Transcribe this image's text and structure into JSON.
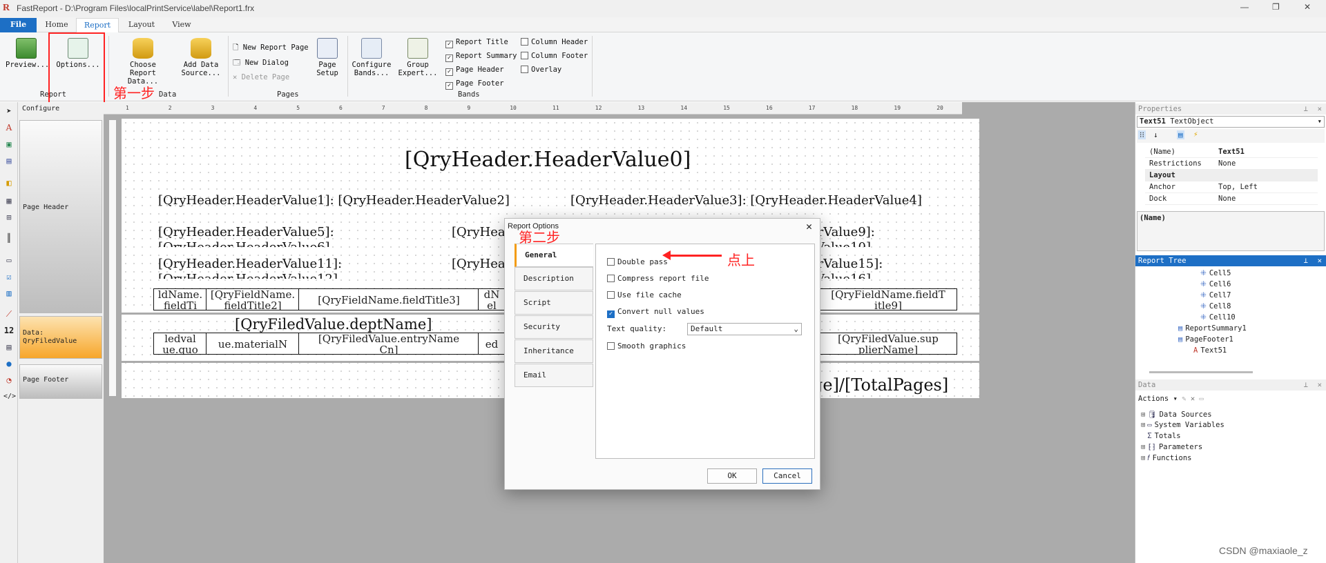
{
  "window": {
    "title": "FastReport - D:\\Program Files\\localPrintService\\label\\Report1.frx",
    "controls": [
      "—",
      "❐",
      "✕"
    ]
  },
  "tabs": [
    "File",
    "Home",
    "Report",
    "Layout",
    "View"
  ],
  "ribbon": {
    "preview": "Preview...",
    "options": "Options...",
    "report_group": "Report",
    "choose_data": "Choose Report Data...",
    "add_source": "Add Data Source...",
    "data_group": "Data",
    "new_page": "New Report Page",
    "new_dialog": "New Dialog",
    "delete_page": "Delete Page",
    "page_setup": "Page Setup",
    "pages_group": "Pages",
    "configure": "Configure Bands...",
    "group_expert": "Group Expert...",
    "bands_group": "Bands",
    "checks": [
      {
        "label": "Report Title",
        "checked": true
      },
      {
        "label": "Report Summary",
        "checked": true
      },
      {
        "label": "Page Header",
        "checked": true
      },
      {
        "label": "Page Footer",
        "checked": true
      },
      {
        "label": "Column Header",
        "checked": false
      },
      {
        "label": "Column Footer",
        "checked": false
      },
      {
        "label": "Overlay",
        "checked": false
      }
    ]
  },
  "annotations": {
    "step1": "第一步",
    "step2": "第二步",
    "click": "点上",
    "watermark": "CSDN @maxiaole_z"
  },
  "left_panel": {
    "configure": "Configure",
    "bands": [
      "Page Header",
      "Data: QryFiledValue",
      "Page Footer"
    ]
  },
  "ruler": [
    "1",
    "2",
    "3",
    "4",
    "5",
    "6",
    "7",
    "8",
    "9",
    "10",
    "11",
    "12",
    "13",
    "14",
    "15",
    "16",
    "17",
    "18",
    "19",
    "20"
  ],
  "report": {
    "header0": "[QryHeader.HeaderValue0]",
    "row1a": "[QryHeader.HeaderValue1]: [QryHeader.HeaderValue2]",
    "row1b": "[QryHeader.HeaderValue3]: [QryHeader.HeaderValue4]",
    "row2a": "[QryHeader.HeaderValue5]:",
    "row2a2": "[QryHeader.HeaderValue6]",
    "row2b": "[QryHeade",
    "row2c": "erValue9]:",
    "row2c2": "Value10]",
    "row3a": "[QryHeader.HeaderValue11]:",
    "row3a2": "[QryHeader.HeaderValue12]",
    "row3b": "[QryHeade",
    "row3c": "erValue15]:",
    "row3c2": "Value16]",
    "cells_top": [
      "ldName.\nfieldTi",
      "[QryFieldName.\nfieldTitle2]",
      "[QryFieldName.fieldTitle3]",
      "dN\nel",
      "[QryFieldName.fieldT\nitle9]"
    ],
    "dept": "[QryFiledValue.deptName]",
    "cells_bottom": [
      "ledval\nue.quo",
      "ue.materialN",
      "[QryFiledValue.entryName\nCn]",
      "ed",
      "[QryFiledValue.sup\nplierName]"
    ],
    "footer": "ge]/[TotalPages]"
  },
  "dialog": {
    "title": "Report Options",
    "tabs": [
      "General",
      "Description",
      "Script",
      "Security",
      "Inheritance",
      "Email"
    ],
    "options": [
      {
        "label": "Double pass",
        "checked": false
      },
      {
        "label": "Compress report file",
        "checked": false
      },
      {
        "label": "Use file cache",
        "checked": false
      },
      {
        "label": "Convert null values",
        "checked": true
      }
    ],
    "quality_label": "Text quality:",
    "quality_value": "Default",
    "smooth": "Smooth graphics",
    "ok": "OK",
    "cancel": "Cancel"
  },
  "properties": {
    "header": "Properties",
    "object": "Text51",
    "object_type": "TextObject",
    "rows": [
      [
        "(Name)",
        "Text51"
      ],
      [
        "Restrictions",
        "None"
      ],
      [
        "Layout",
        ""
      ],
      [
        "Anchor",
        "Top, Left"
      ],
      [
        "Dock",
        "None"
      ]
    ],
    "desc": "(Name)"
  },
  "report_tree": {
    "header": "Report Tree",
    "items": [
      "Cell5",
      "Cell6",
      "Cell7",
      "Cell8",
      "Cell10",
      "ReportSummary1",
      "PageFooter1",
      "Text51"
    ]
  },
  "data_panel": {
    "header": "Data",
    "actions": "Actions",
    "items": [
      "Data Sources",
      "System Variables",
      "Totals",
      "Parameters",
      "Functions"
    ]
  }
}
